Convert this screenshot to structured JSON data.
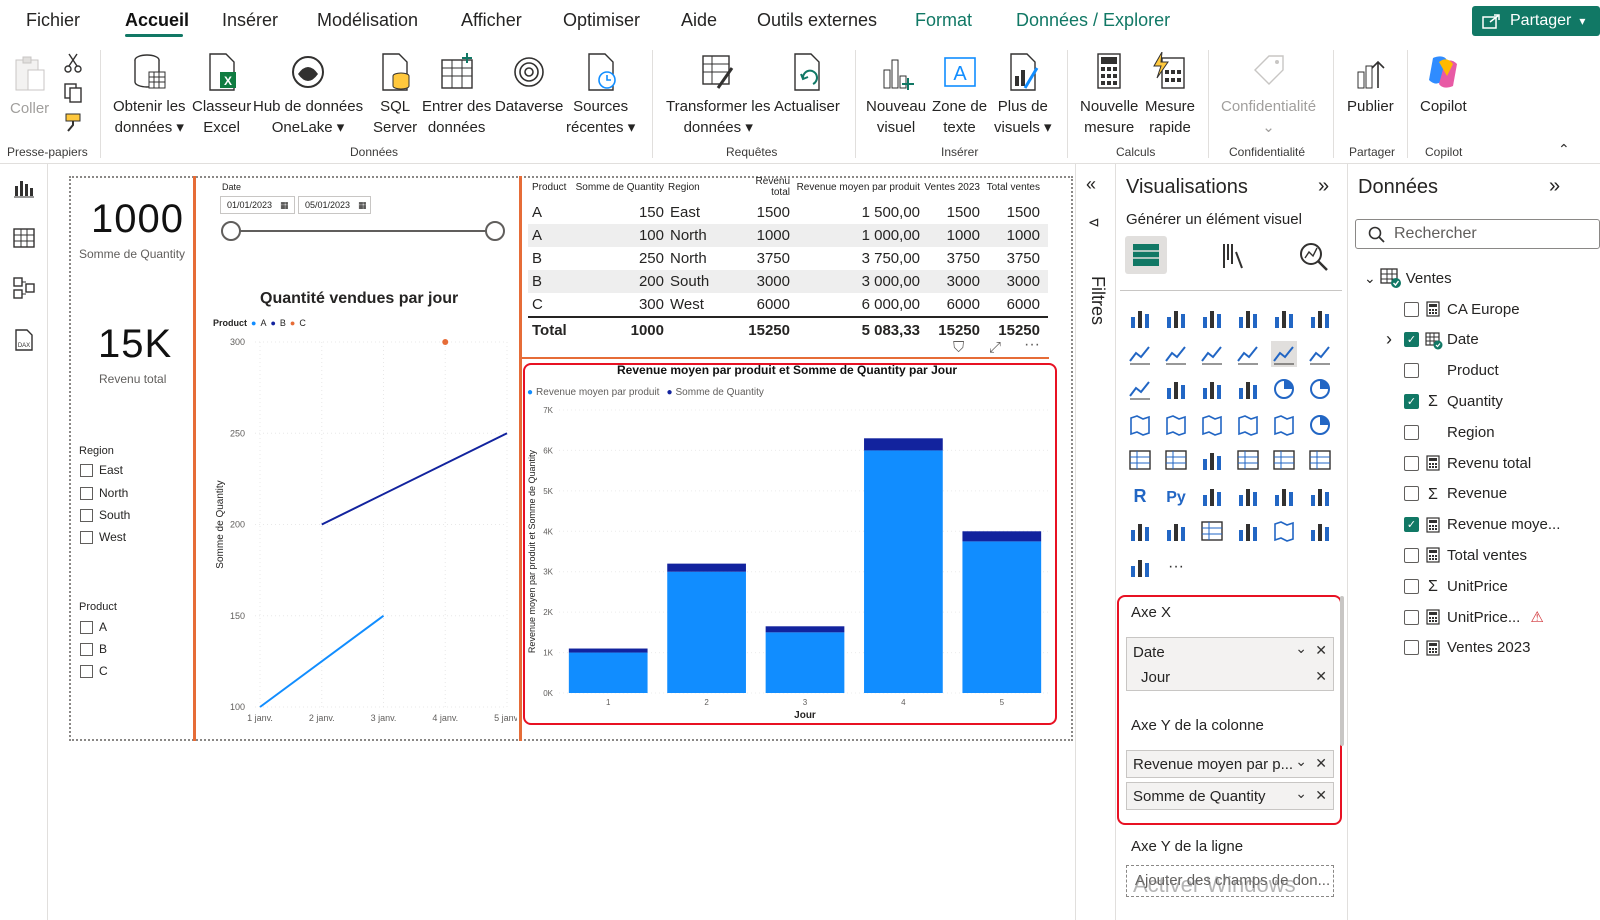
{
  "menu": {
    "items": [
      "Fichier",
      "Accueil",
      "Insérer",
      "Modélisation",
      "Afficher",
      "Optimiser",
      "Aide",
      "Outils externes",
      "Format",
      "Données / Explorer"
    ],
    "active": "Accueil",
    "share_label": "Partager"
  },
  "ribbon": {
    "clipboard": {
      "paste": "Coller",
      "group": "Presse-papiers"
    },
    "data": {
      "get_data": [
        "Obtenir les",
        "données"
      ],
      "excel": [
        "Classeur",
        "Excel"
      ],
      "onelake": [
        "Hub de données",
        "OneLake"
      ],
      "sql": [
        "SQL",
        "Server"
      ],
      "enter": [
        "Entrer des",
        "données"
      ],
      "dataverse": "Dataverse",
      "recent": [
        "Sources",
        "récentes"
      ],
      "group": "Données"
    },
    "queries": {
      "transform": [
        "Transformer les",
        "données"
      ],
      "refresh": "Actualiser",
      "group": "Requêtes"
    },
    "insert": {
      "new_visual": [
        "Nouveau",
        "visuel"
      ],
      "textbox": [
        "Zone de",
        "texte"
      ],
      "more": [
        "Plus de",
        "visuels"
      ],
      "group": "Insérer"
    },
    "calc": {
      "new_measure": [
        "Nouvelle",
        "mesure"
      ],
      "quick_measure": [
        "Mesure",
        "rapide"
      ],
      "group": "Calculs"
    },
    "sensitivity": {
      "label": "Confidentialité",
      "group": "Confidentialité"
    },
    "share": {
      "publish": "Publier",
      "group": "Partager"
    },
    "copilot": {
      "label": "Copilot",
      "group": "Copilot"
    }
  },
  "cards": [
    {
      "value": "1000",
      "label": "Somme de Quantity"
    },
    {
      "value": "15K",
      "label": "Revenu total"
    }
  ],
  "slicers": {
    "region": {
      "title": "Region",
      "items": [
        "East",
        "North",
        "South",
        "West"
      ]
    },
    "product": {
      "title": "Product",
      "items": [
        "A",
        "B",
        "C"
      ]
    },
    "date": {
      "title": "Date",
      "start": "01/01/2023",
      "end": "05/01/2023"
    }
  },
  "line_chart": {
    "title": "Quantité vendues par jour",
    "legend_title": "Product",
    "legend": [
      "A",
      "B",
      "C"
    ],
    "ylabel": "Somme de Quantity",
    "yticks": [
      "300",
      "250",
      "200",
      "150",
      "100"
    ],
    "xticks": [
      "1 janv.",
      "2 janv.",
      "3 janv.",
      "4 janv.",
      "5 janv."
    ]
  },
  "table": {
    "headers": [
      "Product",
      "Somme de Quantity",
      "Region",
      "Revenu total",
      "Revenue moyen par produit",
      "Ventes 2023",
      "Total ventes"
    ],
    "rows": [
      [
        "A",
        "150",
        "East",
        "1500",
        "1 500,00",
        "1500",
        "1500"
      ],
      [
        "A",
        "100",
        "North",
        "1000",
        "1 000,00",
        "1000",
        "1000"
      ],
      [
        "B",
        "250",
        "North",
        "3750",
        "3 750,00",
        "3750",
        "3750"
      ],
      [
        "B",
        "200",
        "South",
        "3000",
        "3 000,00",
        "3000",
        "3000"
      ],
      [
        "C",
        "300",
        "West",
        "6000",
        "6 000,00",
        "6000",
        "6000"
      ]
    ],
    "total": [
      "Total",
      "1000",
      "",
      "15250",
      "5 083,33",
      "15250",
      "15250"
    ]
  },
  "chart_data": [
    {
      "type": "line",
      "title": "Quantité vendues par jour",
      "xlabel": "",
      "ylabel": "Somme de Quantity",
      "x": [
        "1 janv.",
        "2 janv.",
        "3 janv.",
        "4 janv.",
        "5 janv."
      ],
      "ylim": [
        100,
        300
      ],
      "series": [
        {
          "name": "A",
          "color": "#118dff",
          "values": [
            100,
            null,
            150,
            null,
            null
          ]
        },
        {
          "name": "B",
          "color": "#12239e",
          "values": [
            null,
            200,
            null,
            null,
            250
          ]
        },
        {
          "name": "C",
          "color": "#e66c37",
          "values": [
            null,
            null,
            null,
            300,
            null
          ]
        }
      ]
    },
    {
      "type": "bar",
      "stacked": true,
      "title": "Revenue moyen par produit et Somme de Quantity par Jour",
      "xlabel": "Jour",
      "ylabel": "Revenue moyen par produit et Somme de Quantity",
      "categories": [
        "1",
        "2",
        "3",
        "4",
        "5"
      ],
      "yticks": [
        "7K",
        "6K",
        "5K",
        "4K",
        "3K",
        "2K",
        "1K",
        "0K"
      ],
      "ylim": [
        0,
        7000
      ],
      "series": [
        {
          "name": "Revenue moyen par produit",
          "color": "#118dff",
          "values": [
            1000,
            3000,
            1500,
            6000,
            3750
          ]
        },
        {
          "name": "Somme de Quantity",
          "color": "#12239e",
          "values": [
            100,
            200,
            150,
            300,
            250
          ]
        }
      ]
    }
  ],
  "filters_label": "Filtres",
  "visualizations": {
    "title": "Visualisations",
    "subtitle": "Générer un élément visuel",
    "wells": {
      "x_axis": "Axe X",
      "x_fields": [
        "Date",
        "Jour"
      ],
      "y_column": "Axe Y de la colonne",
      "y_fields": [
        "Revenue moyen par p...",
        "Somme de Quantity"
      ],
      "y_line": "Axe Y de la ligne",
      "add_placeholder": "Ajouter des champs de don..."
    },
    "text_icons": [
      "R",
      "Py"
    ],
    "more": "···"
  },
  "data_pane": {
    "title": "Données",
    "search_placeholder": "Rechercher",
    "table": "Ventes",
    "fields": [
      {
        "name": "CA Europe",
        "checked": false,
        "icon": "calc-icon"
      },
      {
        "name": "Date",
        "checked": true,
        "icon": "table-icon",
        "expandable": true
      },
      {
        "name": "Product",
        "checked": false,
        "icon": ""
      },
      {
        "name": "Quantity",
        "checked": true,
        "icon": "sigma-icon"
      },
      {
        "name": "Region",
        "checked": false,
        "icon": ""
      },
      {
        "name": "Revenu total",
        "checked": false,
        "icon": "calc-icon"
      },
      {
        "name": "Revenue",
        "checked": false,
        "icon": "sigma-icon"
      },
      {
        "name": "Revenue moye...",
        "checked": true,
        "icon": "calc-icon"
      },
      {
        "name": "Total ventes",
        "checked": false,
        "icon": "calc-icon"
      },
      {
        "name": "UnitPrice",
        "checked": false,
        "icon": "sigma-icon"
      },
      {
        "name": "UnitPrice...",
        "checked": false,
        "icon": "calc-icon",
        "warning": true
      },
      {
        "name": "Ventes 2023",
        "checked": false,
        "icon": "calc-icon"
      }
    ]
  },
  "watermark": "Activer Windows"
}
